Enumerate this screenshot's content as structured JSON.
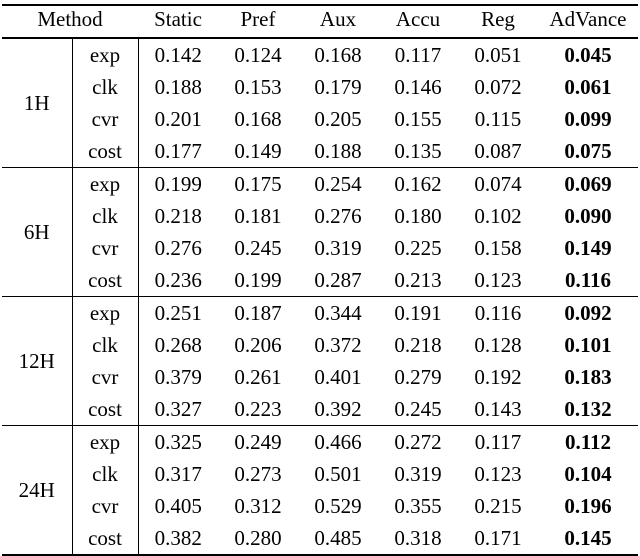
{
  "table": {
    "headers": [
      "Method",
      "Static",
      "Pref",
      "Aux",
      "Accu",
      "Reg",
      "AdVance"
    ],
    "highlight_column": "AdVance",
    "metric_rows": [
      "exp",
      "clk",
      "cvr",
      "cost"
    ],
    "groups": [
      {
        "label": "1H",
        "rows": [
          {
            "metric": "exp",
            "Static": "0.142",
            "Pref": "0.124",
            "Aux": "0.168",
            "Accu": "0.117",
            "Reg": "0.051",
            "AdVance": "0.045"
          },
          {
            "metric": "clk",
            "Static": "0.188",
            "Pref": "0.153",
            "Aux": "0.179",
            "Accu": "0.146",
            "Reg": "0.072",
            "AdVance": "0.061"
          },
          {
            "metric": "cvr",
            "Static": "0.201",
            "Pref": "0.168",
            "Aux": "0.205",
            "Accu": "0.155",
            "Reg": "0.115",
            "AdVance": "0.099"
          },
          {
            "metric": "cost",
            "Static": "0.177",
            "Pref": "0.149",
            "Aux": "0.188",
            "Accu": "0.135",
            "Reg": "0.087",
            "AdVance": "0.075"
          }
        ]
      },
      {
        "label": "6H",
        "rows": [
          {
            "metric": "exp",
            "Static": "0.199",
            "Pref": "0.175",
            "Aux": "0.254",
            "Accu": "0.162",
            "Reg": "0.074",
            "AdVance": "0.069"
          },
          {
            "metric": "clk",
            "Static": "0.218",
            "Pref": "0.181",
            "Aux": "0.276",
            "Accu": "0.180",
            "Reg": "0.102",
            "AdVance": "0.090"
          },
          {
            "metric": "cvr",
            "Static": "0.276",
            "Pref": "0.245",
            "Aux": "0.319",
            "Accu": "0.225",
            "Reg": "0.158",
            "AdVance": "0.149"
          },
          {
            "metric": "cost",
            "Static": "0.236",
            "Pref": "0.199",
            "Aux": "0.287",
            "Accu": "0.213",
            "Reg": "0.123",
            "AdVance": "0.116"
          }
        ]
      },
      {
        "label": "12H",
        "rows": [
          {
            "metric": "exp",
            "Static": "0.251",
            "Pref": "0.187",
            "Aux": "0.344",
            "Accu": "0.191",
            "Reg": "0.116",
            "AdVance": "0.092"
          },
          {
            "metric": "clk",
            "Static": "0.268",
            "Pref": "0.206",
            "Aux": "0.372",
            "Accu": "0.218",
            "Reg": "0.128",
            "AdVance": "0.101"
          },
          {
            "metric": "cvr",
            "Static": "0.379",
            "Pref": "0.261",
            "Aux": "0.401",
            "Accu": "0.279",
            "Reg": "0.192",
            "AdVance": "0.183"
          },
          {
            "metric": "cost",
            "Static": "0.327",
            "Pref": "0.223",
            "Aux": "0.392",
            "Accu": "0.245",
            "Reg": "0.143",
            "AdVance": "0.132"
          }
        ]
      },
      {
        "label": "24H",
        "rows": [
          {
            "metric": "exp",
            "Static": "0.325",
            "Pref": "0.249",
            "Aux": "0.466",
            "Accu": "0.272",
            "Reg": "0.117",
            "AdVance": "0.112"
          },
          {
            "metric": "clk",
            "Static": "0.317",
            "Pref": "0.273",
            "Aux": "0.501",
            "Accu": "0.319",
            "Reg": "0.123",
            "AdVance": "0.104"
          },
          {
            "metric": "cvr",
            "Static": "0.405",
            "Pref": "0.312",
            "Aux": "0.529",
            "Accu": "0.355",
            "Reg": "0.215",
            "AdVance": "0.196"
          },
          {
            "metric": "cost",
            "Static": "0.382",
            "Pref": "0.280",
            "Aux": "0.485",
            "Accu": "0.318",
            "Reg": "0.171",
            "AdVance": "0.145"
          }
        ]
      }
    ]
  },
  "colors": {
    "text": "#000000",
    "rule": "#000000",
    "background": "#ffffff"
  }
}
